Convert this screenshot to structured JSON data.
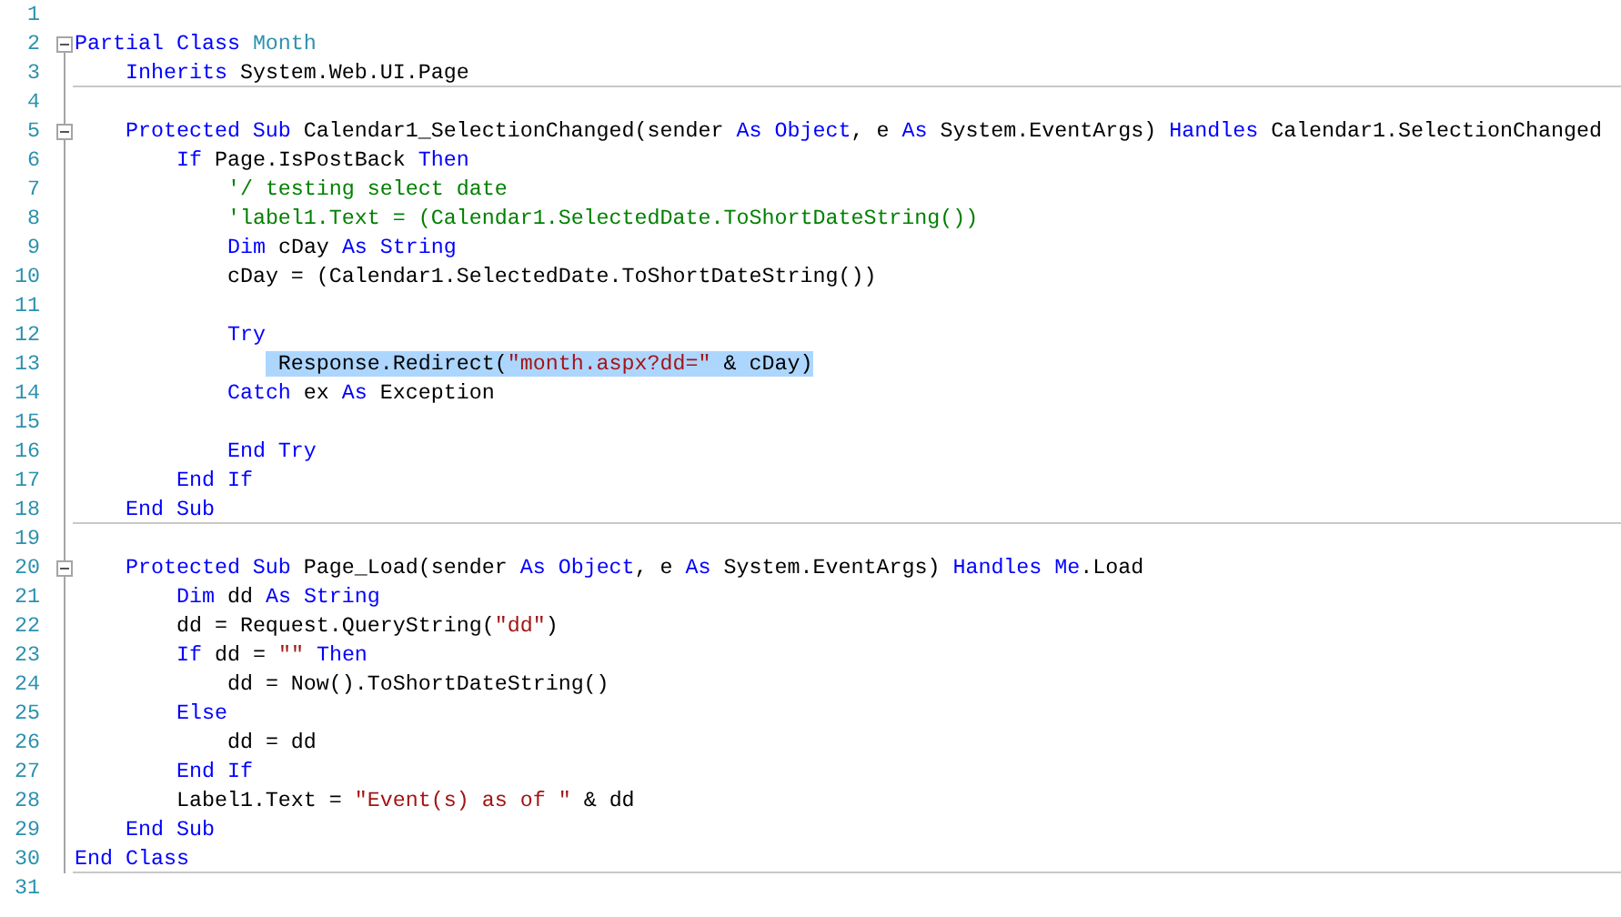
{
  "lines": [
    {
      "number": "1",
      "collapsible": false,
      "separator": false,
      "selected": false
    },
    {
      "number": "2",
      "collapsible": true,
      "separator": false,
      "selected": false,
      "tokens": [
        {
          "kind": "keyword",
          "text": "Partial Class "
        },
        {
          "kind": "type",
          "text": "Month"
        }
      ]
    },
    {
      "number": "3",
      "collapsible": false,
      "separator": true,
      "selected": false,
      "tokens": [
        {
          "kind": "keyword",
          "text": "    Inherits"
        },
        {
          "kind": "plain",
          "text": " System.Web.UI.Page"
        }
      ]
    },
    {
      "number": "4",
      "collapsible": false,
      "separator": false,
      "selected": false
    },
    {
      "number": "5",
      "collapsible": true,
      "separator": false,
      "selected": false,
      "tokens": [
        {
          "kind": "keyword",
          "text": "    Protected Sub"
        },
        {
          "kind": "plain",
          "text": " Calendar1_SelectionChanged(sender "
        },
        {
          "kind": "keyword",
          "text": "As Object"
        },
        {
          "kind": "plain",
          "text": ", e "
        },
        {
          "kind": "keyword",
          "text": "As"
        },
        {
          "kind": "plain",
          "text": " System.EventArgs) "
        },
        {
          "kind": "keyword",
          "text": "Handles"
        },
        {
          "kind": "plain",
          "text": " Calendar1.SelectionChanged"
        }
      ]
    },
    {
      "number": "6",
      "collapsible": false,
      "separator": false,
      "selected": false,
      "tokens": [
        {
          "kind": "keyword",
          "text": "        If"
        },
        {
          "kind": "plain",
          "text": " Page.IsPostBack "
        },
        {
          "kind": "keyword",
          "text": "Then"
        }
      ]
    },
    {
      "number": "7",
      "collapsible": false,
      "separator": false,
      "selected": false,
      "tokens": [
        {
          "kind": "comment",
          "text": "            '/ testing select date"
        }
      ]
    },
    {
      "number": "8",
      "collapsible": false,
      "separator": false,
      "selected": false,
      "tokens": [
        {
          "kind": "comment",
          "text": "            'label1.Text = (Calendar1.SelectedDate.ToShortDateString())"
        }
      ]
    },
    {
      "number": "9",
      "collapsible": false,
      "separator": false,
      "selected": false,
      "tokens": [
        {
          "kind": "keyword",
          "text": "            Dim"
        },
        {
          "kind": "plain",
          "text": " cDay "
        },
        {
          "kind": "keyword",
          "text": "As String"
        }
      ]
    },
    {
      "number": "10",
      "collapsible": false,
      "separator": false,
      "selected": false,
      "tokens": [
        {
          "kind": "plain",
          "text": "            cDay = (Calendar1.SelectedDate.ToShortDateString())"
        }
      ]
    },
    {
      "number": "11",
      "collapsible": false,
      "separator": false,
      "selected": false
    },
    {
      "number": "12",
      "collapsible": false,
      "separator": false,
      "selected": false,
      "tokens": [
        {
          "kind": "keyword",
          "text": "            Try"
        }
      ]
    },
    {
      "number": "13",
      "collapsible": false,
      "separator": false,
      "selected": true,
      "tokens": [
        {
          "kind": "plain",
          "text": "                Response.Redirect("
        },
        {
          "kind": "string",
          "text": "\"month.aspx?dd=\""
        },
        {
          "kind": "plain",
          "text": " & cDay)"
        }
      ]
    },
    {
      "number": "14",
      "collapsible": false,
      "separator": false,
      "selected": false,
      "tokens": [
        {
          "kind": "keyword",
          "text": "            Catch"
        },
        {
          "kind": "plain",
          "text": " ex "
        },
        {
          "kind": "keyword",
          "text": "As"
        },
        {
          "kind": "plain",
          "text": " Exception"
        }
      ]
    },
    {
      "number": "15",
      "collapsible": false,
      "separator": false,
      "selected": false
    },
    {
      "number": "16",
      "collapsible": false,
      "separator": false,
      "selected": false,
      "tokens": [
        {
          "kind": "keyword",
          "text": "            End Try"
        }
      ]
    },
    {
      "number": "17",
      "collapsible": false,
      "separator": false,
      "selected": false,
      "tokens": [
        {
          "kind": "keyword",
          "text": "        End If"
        }
      ]
    },
    {
      "number": "18",
      "collapsible": false,
      "separator": true,
      "selected": false,
      "tokens": [
        {
          "kind": "keyword",
          "text": "    End Sub"
        }
      ]
    },
    {
      "number": "19",
      "collapsible": false,
      "separator": false,
      "selected": false
    },
    {
      "number": "20",
      "collapsible": true,
      "separator": false,
      "selected": false,
      "tokens": [
        {
          "kind": "keyword",
          "text": "    Protected Sub"
        },
        {
          "kind": "plain",
          "text": " Page_Load(sender "
        },
        {
          "kind": "keyword",
          "text": "As Object"
        },
        {
          "kind": "plain",
          "text": ", e "
        },
        {
          "kind": "keyword",
          "text": "As"
        },
        {
          "kind": "plain",
          "text": " System.EventArgs) "
        },
        {
          "kind": "keyword",
          "text": "Handles Me"
        },
        {
          "kind": "plain",
          "text": ".Load"
        }
      ]
    },
    {
      "number": "21",
      "collapsible": false,
      "separator": false,
      "selected": false,
      "tokens": [
        {
          "kind": "keyword",
          "text": "        Dim"
        },
        {
          "kind": "plain",
          "text": " dd "
        },
        {
          "kind": "keyword",
          "text": "As String"
        }
      ]
    },
    {
      "number": "22",
      "collapsible": false,
      "separator": false,
      "selected": false,
      "tokens": [
        {
          "kind": "plain",
          "text": "        dd = Request.QueryString("
        },
        {
          "kind": "string",
          "text": "\"dd\""
        },
        {
          "kind": "plain",
          "text": ")"
        }
      ]
    },
    {
      "number": "23",
      "collapsible": false,
      "separator": false,
      "selected": false,
      "tokens": [
        {
          "kind": "keyword",
          "text": "        If"
        },
        {
          "kind": "plain",
          "text": " dd = "
        },
        {
          "kind": "string",
          "text": "\"\""
        },
        {
          "kind": "keyword",
          "text": " Then"
        }
      ]
    },
    {
      "number": "24",
      "collapsible": false,
      "separator": false,
      "selected": false,
      "tokens": [
        {
          "kind": "plain",
          "text": "            dd = Now().ToShortDateString()"
        }
      ]
    },
    {
      "number": "25",
      "collapsible": false,
      "separator": false,
      "selected": false,
      "tokens": [
        {
          "kind": "keyword",
          "text": "        Else"
        }
      ]
    },
    {
      "number": "26",
      "collapsible": false,
      "separator": false,
      "selected": false,
      "tokens": [
        {
          "kind": "plain",
          "text": "            dd = dd"
        }
      ]
    },
    {
      "number": "27",
      "collapsible": false,
      "separator": false,
      "selected": false,
      "tokens": [
        {
          "kind": "keyword",
          "text": "        End If"
        }
      ]
    },
    {
      "number": "28",
      "collapsible": false,
      "separator": false,
      "selected": false,
      "tokens": [
        {
          "kind": "plain",
          "text": "        Label1.Text = "
        },
        {
          "kind": "string",
          "text": "\"Event(s) as of \""
        },
        {
          "kind": "plain",
          "text": " & dd"
        }
      ]
    },
    {
      "number": "29",
      "collapsible": false,
      "separator": false,
      "selected": false,
      "tokens": [
        {
          "kind": "keyword",
          "text": "    End Sub"
        }
      ]
    },
    {
      "number": "30",
      "collapsible": false,
      "separator": true,
      "selected": false,
      "tokens": [
        {
          "kind": "keyword",
          "text": "End Class"
        }
      ]
    },
    {
      "number": "31",
      "collapsible": false,
      "separator": false,
      "selected": false
    }
  ]
}
